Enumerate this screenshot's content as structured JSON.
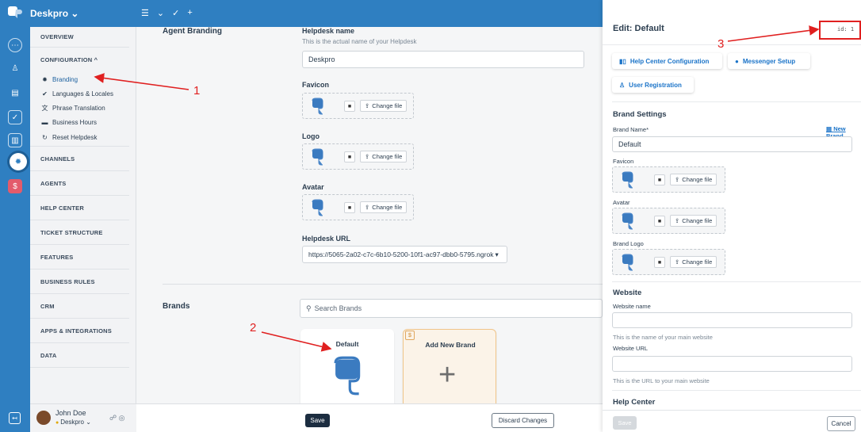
{
  "app": {
    "name": "Deskpro"
  },
  "nav": {
    "overview": "OVERVIEW",
    "configuration": "CONFIGURATION ^",
    "config_items": [
      {
        "label": "Branding",
        "icon": "sun-icon"
      },
      {
        "label": "Languages & Locales",
        "icon": "checkmark-circle-icon"
      },
      {
        "label": "Phrase Translation",
        "icon": "translate-icon"
      },
      {
        "label": "Business Hours",
        "icon": "calendar-icon"
      },
      {
        "label": "Reset Helpdesk",
        "icon": "reset-icon"
      }
    ],
    "sections": [
      "CHANNELS",
      "AGENTS",
      "HELP CENTER",
      "TICKET STRUCTURE",
      "FEATURES",
      "BUSINESS RULES",
      "CRM",
      "APPS & INTEGRATIONS",
      "DATA"
    ]
  },
  "user": {
    "name": "John Doe",
    "org": "Deskpro"
  },
  "main": {
    "agent_branding": "Agent Branding",
    "helpdesk_name_label": "Helpdesk name",
    "helpdesk_name_hint": "This is the actual name of your Helpdesk",
    "helpdesk_name_value": "Deskpro",
    "favicon_label": "Favicon",
    "logo_label": "Logo",
    "avatar_label": "Avatar",
    "change_file": "Change file",
    "helpdesk_url_label": "Helpdesk URL",
    "helpdesk_url_value": "https://5065-2a02-c7c-6b10-5200-10f1-ac97-dbb0-5795.ngrok",
    "brands_label": "Brands",
    "search_brands_placeholder": "Search Brands",
    "brand_default": "Default",
    "brand_add": "Add New Brand",
    "add_badge": "$",
    "save": "Save",
    "discard": "Discard Changes"
  },
  "panel": {
    "title": "Edit: Default",
    "id_label": "id: 1",
    "buttons": [
      "Help Center Configuration",
      "Messenger Setup",
      "User Registration"
    ],
    "brand_settings": "Brand Settings",
    "brand_name_label": "Brand Name*",
    "new_brand": "New Brand",
    "brand_name_value": "Default",
    "favicon": "Favicon",
    "avatar": "Avatar",
    "brand_logo": "Brand Logo",
    "change_file": "Change file",
    "website": "Website",
    "website_name": "Website name",
    "website_name_hint": "This is the name of your main website",
    "website_url": "Website URL",
    "website_url_hint": "This is the URL to your main website",
    "help_center": "Help Center",
    "save": "Save",
    "cancel": "Cancel"
  },
  "annotations": [
    "1",
    "2",
    "3"
  ],
  "colors": {
    "brand_blue": "#2f7fc1",
    "annotation_red": "#e02020",
    "accent_orange": "#f0c58a"
  }
}
